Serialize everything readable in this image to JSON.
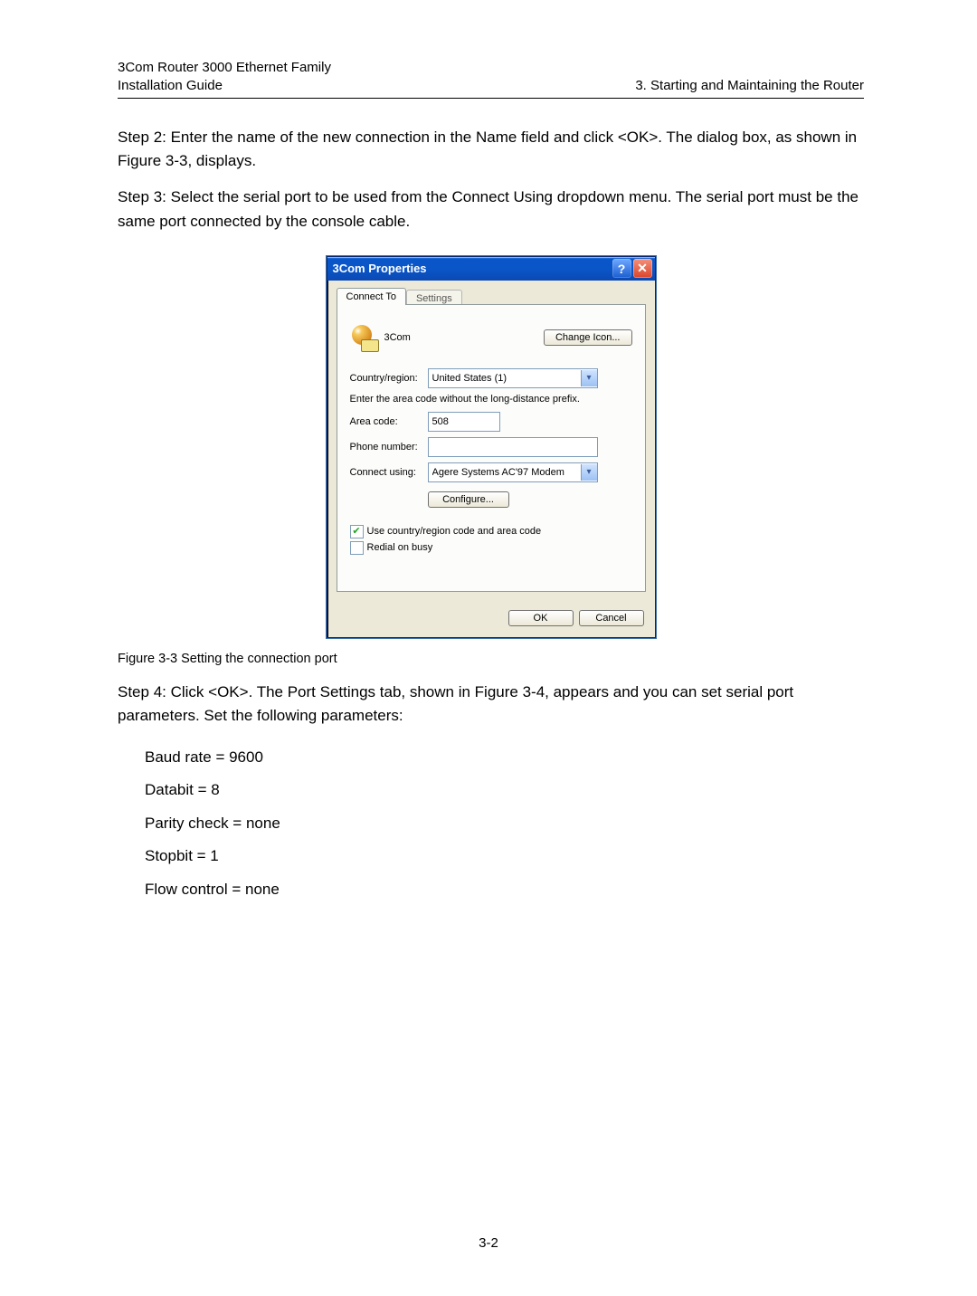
{
  "header": {
    "line1": "3Com Router 3000 Ethernet Family",
    "line2": "Installation Guide",
    "right": "3. Starting and Maintaining the Router"
  },
  "step2": "Step 2: Enter the name of the new connection in the Name field and click <OK>. The dialog box, as shown in Figure 3-3, displays.",
  "step3": "Step 3: Select the serial port to be used from the Connect Using dropdown menu. The serial port must be the same port connected by the console cable.",
  "dialog": {
    "title": "3Com Properties",
    "tabs": {
      "active": "Connect To",
      "inactive": "Settings"
    },
    "conn_name": "3Com",
    "change_icon": "Change Icon...",
    "country_label": "Country/region:",
    "country_value": "United States (1)",
    "areacode_hint": "Enter the area code without the long-distance prefix.",
    "areacode_label": "Area code:",
    "areacode_value": "508",
    "phone_label": "Phone number:",
    "phone_value": "",
    "connectusing_label": "Connect using:",
    "connectusing_value": "Agere Systems AC'97 Modem",
    "configure": "Configure...",
    "chk1": "Use country/region code and area code",
    "chk2": "Redial on busy",
    "ok": "OK",
    "cancel": "Cancel"
  },
  "figcaption_prefix": "Figure 3-3",
  "figcaption_text": " Setting the connection port",
  "step4": "Step 4: Click <OK>. The Port Settings tab, shown in Figure 3-4, appears and you can set serial port parameters. Set the following parameters:",
  "params": [
    "Baud rate = 9600",
    "Databit = 8",
    "Parity check = none",
    "Stopbit = 1",
    "Flow control = none"
  ],
  "pagenum": "3-2"
}
